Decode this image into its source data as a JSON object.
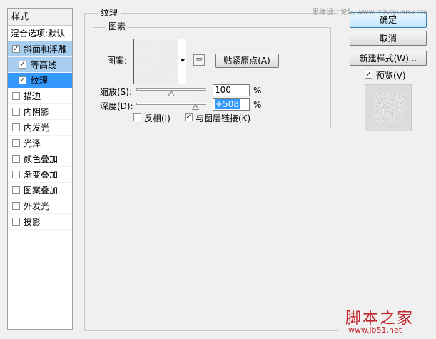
{
  "styles_panel": {
    "header": "样式",
    "items": [
      {
        "label": "混合选项:默认",
        "checkbox": false,
        "checked": false,
        "level": 0,
        "state": "normal"
      },
      {
        "label": "斜面和浮雕",
        "checkbox": true,
        "checked": true,
        "level": 0,
        "state": "selected"
      },
      {
        "label": "等高线",
        "checkbox": true,
        "checked": true,
        "level": 1,
        "state": "selected"
      },
      {
        "label": "纹理",
        "checkbox": true,
        "checked": true,
        "level": 1,
        "state": "active"
      },
      {
        "label": "描边",
        "checkbox": true,
        "checked": false,
        "level": 0,
        "state": "normal"
      },
      {
        "label": "内阴影",
        "checkbox": true,
        "checked": false,
        "level": 0,
        "state": "normal"
      },
      {
        "label": "内发光",
        "checkbox": true,
        "checked": false,
        "level": 0,
        "state": "normal"
      },
      {
        "label": "光泽",
        "checkbox": true,
        "checked": false,
        "level": 0,
        "state": "normal"
      },
      {
        "label": "颜色叠加",
        "checkbox": true,
        "checked": false,
        "level": 0,
        "state": "normal"
      },
      {
        "label": "渐变叠加",
        "checkbox": true,
        "checked": false,
        "level": 0,
        "state": "normal"
      },
      {
        "label": "图案叠加",
        "checkbox": true,
        "checked": false,
        "level": 0,
        "state": "normal"
      },
      {
        "label": "外发光",
        "checkbox": true,
        "checked": false,
        "level": 0,
        "state": "normal"
      },
      {
        "label": "投影",
        "checkbox": true,
        "checked": false,
        "level": 0,
        "state": "normal"
      }
    ],
    "check_glyph": "✓"
  },
  "texture": {
    "group_title": "纹理",
    "pattern_group_title": "图素",
    "pattern_label": "图案:",
    "snap_button": "贴紧原点(A)",
    "new_preset_icon": "new-preset-icon",
    "scale": {
      "label": "缩放(S):",
      "value": "100",
      "unit": "%",
      "level": 0.5
    },
    "depth": {
      "label": "深度(D):",
      "value": "+508",
      "unit": "%",
      "level": 0.85
    },
    "invert": {
      "label": "反相(I)",
      "checked": false
    },
    "link": {
      "label": "与图层链接(K)",
      "checked": true
    }
  },
  "buttons": {
    "ok": "确定",
    "cancel": "取消",
    "new_style": "新建样式(W)..."
  },
  "preview": {
    "label": "预览(V)",
    "checked": true
  },
  "watermarks": {
    "top": "思缘设计论坛 www.missyuan.com",
    "bottom": "脚本之家",
    "url": "www.jb51.net"
  },
  "colors": {
    "selection_light": "#a8ceef",
    "selection_active": "#3399ff",
    "watermark_red": "#c0282d"
  }
}
